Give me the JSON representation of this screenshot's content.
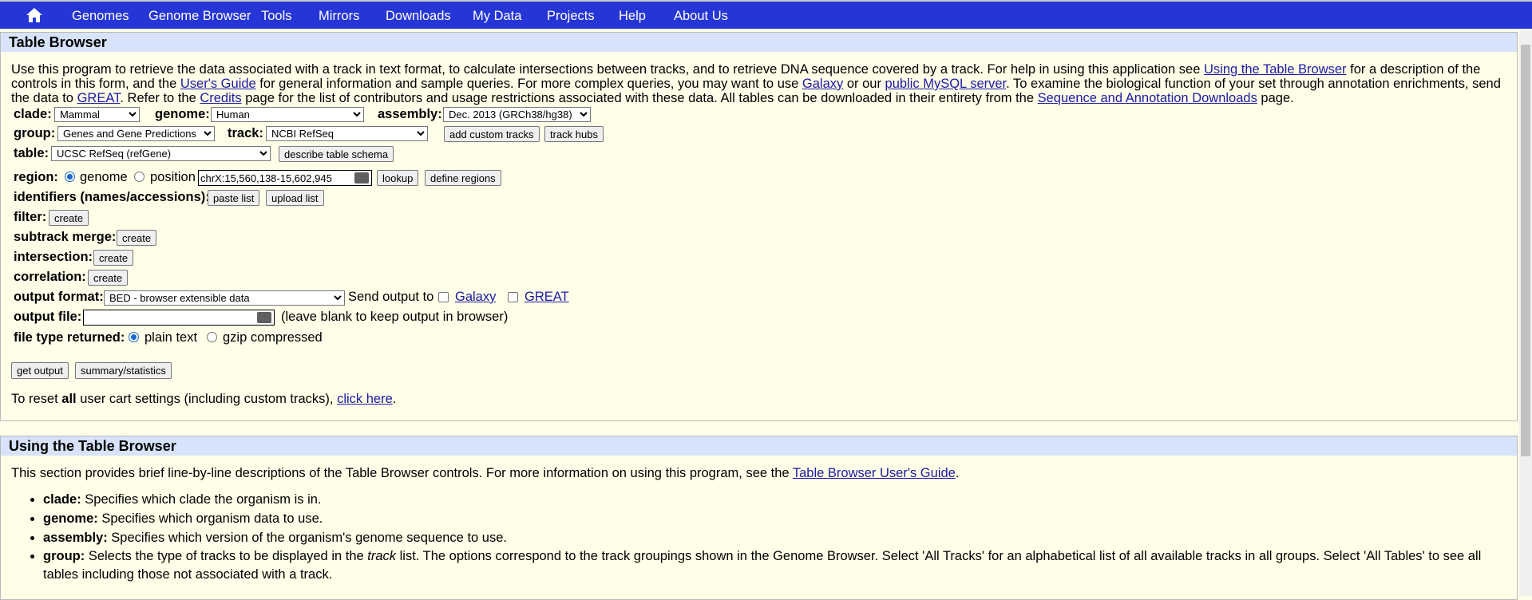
{
  "nav": {
    "home_icon": "home-icon",
    "items": [
      "Genomes",
      "Genome Browser",
      "Tools",
      "Mirrors",
      "Downloads",
      "My Data",
      "Projects",
      "Help",
      "About Us"
    ]
  },
  "table_browser": {
    "title": "Table Browser",
    "intro": {
      "p1": "Use this program to retrieve the data associated with a track in text format, to calculate intersections between tracks, and to retrieve DNA sequence covered by a track. For help in using this application see ",
      "link_using": "Using the Table Browser",
      "p2": " for a description of the controls in this form, and the ",
      "link_guide": "User's Guide",
      "p3": " for general information and sample queries. For more complex queries, you may want to use ",
      "link_galaxy": "Galaxy",
      "p4": " or our ",
      "link_mysql": "public MySQL server",
      "p5": ". To examine the biological function of your set through annotation enrichments, send the data to ",
      "link_great": "GREAT",
      "p6": ". Refer to the ",
      "link_credits": "Credits",
      "p7": " page for the list of contributors and usage restrictions associated with these data. All tables can be downloaded in their entirety from the ",
      "link_downloads": "Sequence and Annotation Downloads",
      "p8": " page."
    },
    "clade_label": "clade:",
    "clade_value": "Mammal",
    "genome_label": "genome:",
    "genome_value": "Human",
    "assembly_label": "assembly:",
    "assembly_value": "Dec. 2013 (GRCh38/hg38)",
    "group_label": "group:",
    "group_value": "Genes and Gene Predictions",
    "track_label": "track:",
    "track_value": "NCBI RefSeq",
    "add_custom_tracks": "add custom tracks",
    "track_hubs": "track hubs",
    "table_label": "table:",
    "table_value": "UCSC RefSeq (refGene)",
    "describe_schema": "describe table schema",
    "region_label": "region:",
    "region_genome": "genome",
    "region_position": "position",
    "position_value": "chrX:15,560,138-15,602,945",
    "lookup": "lookup",
    "define_regions": "define regions",
    "identifiers_label": "identifiers (names/accessions):",
    "paste_list": "paste list",
    "upload_list": "upload list",
    "filter_label": "filter:",
    "subtrack_label": "subtrack merge:",
    "intersection_label": "intersection:",
    "correlation_label": "correlation:",
    "create": "create",
    "output_format_label": "output format:",
    "output_format_value": "BED - browser extensible data",
    "send_output": "Send output to",
    "send_galaxy": "Galaxy",
    "send_great": "GREAT",
    "output_file_label": "output file:",
    "output_file_value": "",
    "output_file_hint": "(leave blank to keep output in browser)",
    "file_type_label": "file type returned:",
    "plain_text": "plain text",
    "gzip": "gzip compressed",
    "get_output": "get output",
    "summary_stats": "summary/statistics",
    "reset_pre": "To reset ",
    "reset_bold": "all",
    "reset_mid": " user cart settings (including custom tracks), ",
    "reset_link": "click here",
    "reset_end": "."
  },
  "using": {
    "title": "Using the Table Browser",
    "intro_pre": "This section provides brief line-by-line descriptions of the Table Browser controls. For more information on using this program, see the ",
    "intro_link": "Table Browser User's Guide",
    "intro_end": ".",
    "items": [
      {
        "term": "clade:",
        "desc": " Specifies which clade the organism is in."
      },
      {
        "term": "genome:",
        "desc": " Specifies which organism data to use."
      },
      {
        "term": "assembly:",
        "desc": " Specifies which version of the organism's genome sequence to use."
      },
      {
        "term": "group:",
        "desc_pre": " Selects the type of tracks to be displayed in the ",
        "desc_em": "track",
        "desc_post": " list. The options correspond to the track groupings shown in the Genome Browser. Select 'All Tracks' for an alphabetical list of all available tracks in all groups. Select 'All Tables' to see all tables including those not associated with a track."
      }
    ]
  }
}
